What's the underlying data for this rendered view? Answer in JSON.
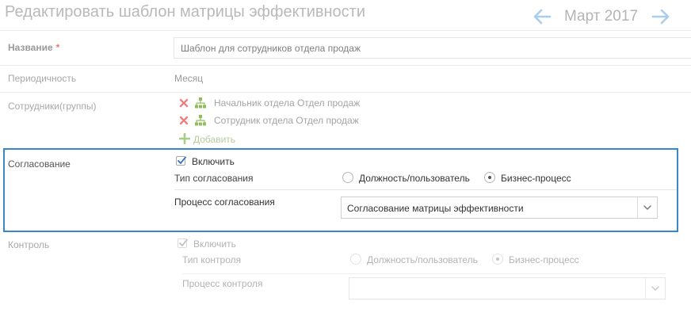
{
  "header": {
    "title": "Редактировать шаблон матрицы эффективности",
    "period_label": "Март 2017"
  },
  "form": {
    "name": {
      "label": "Название",
      "required_mark": "*",
      "value": "Шаблон для сотрудников отдела продаж"
    },
    "periodicity": {
      "label": "Периодичность",
      "value": "Месяц"
    },
    "employees": {
      "label": "Сотрудники(группы)",
      "items": [
        {
          "text": "Начальник отдела Отдел продаж"
        },
        {
          "text": "Сотрудник отдела Отдел продаж"
        }
      ],
      "add_label": "Добавить"
    },
    "approval": {
      "label": "Согласование",
      "enable_label": "Включить",
      "enabled": true,
      "type_label": "Тип согласования",
      "options": [
        "Должность/пользователь",
        "Бизнес-процесс"
      ],
      "selected_option": "Бизнес-процесс",
      "process_label": "Процесс согласования",
      "process_value": "Согласование матрицы эффективности"
    },
    "control": {
      "label": "Контроль",
      "enable_label": "Включить",
      "enabled": true,
      "type_label": "Тип контроля",
      "options": [
        "Должность/пользователь",
        "Бизнес-процесс"
      ],
      "selected_option": "Бизнес-процесс",
      "process_label": "Процесс контроля",
      "process_value": ""
    }
  },
  "colors": {
    "highlight_border": "#3a87c8",
    "remove_icon": "#f08080",
    "group_icon": "#8fbf5a",
    "nav_arrow": "#a9cdea"
  },
  "icons": {
    "prev": "arrow-left-icon",
    "next": "arrow-right-icon",
    "remove": "close-icon",
    "group": "org-tree-icon",
    "add": "plus-icon",
    "dropdown": "chevron-down-icon"
  }
}
